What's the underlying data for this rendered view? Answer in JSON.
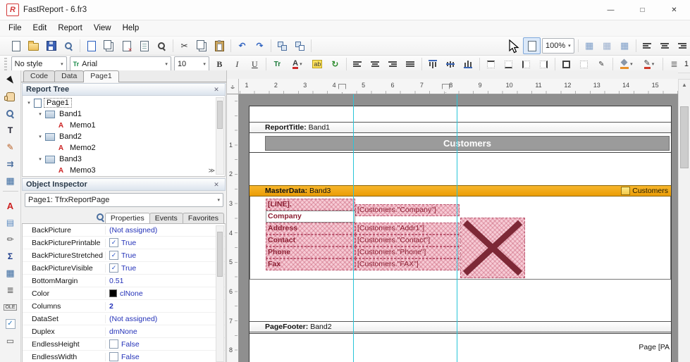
{
  "window": {
    "title": "FastReport - 6.fr3",
    "icon_letter": "R",
    "controls": [
      {
        "name": "minimize-button",
        "glyph": "—"
      },
      {
        "name": "maximize-button",
        "glyph": "□"
      },
      {
        "name": "close-button",
        "glyph": "✕"
      }
    ]
  },
  "menu": {
    "items": [
      "File",
      "Edit",
      "Report",
      "View",
      "Help"
    ]
  },
  "toolbar_main": {
    "zoom_value": "100%",
    "items_a": [
      {
        "name": "new-report-button",
        "cls": "css-page"
      },
      {
        "name": "open-report-button",
        "cls": "css-folder"
      },
      {
        "name": "save-report-button",
        "cls": "css-floppy"
      },
      {
        "name": "preview-button",
        "cls": "css-zoom"
      },
      {
        "name": "separator",
        "cls": "sep"
      },
      {
        "name": "new-report-page-button",
        "cls": "css-page pg-blue"
      },
      {
        "name": "new-dialog-page-button",
        "cls": "css-pages css-copy"
      },
      {
        "name": "delete-page-button",
        "cls": "css-page pg-del"
      },
      {
        "name": "page-settings-button",
        "cls": "css-page pg-set"
      },
      {
        "name": "find-button",
        "cls": "css-zoom zm-dark"
      },
      {
        "name": "separator",
        "cls": "sep"
      },
      {
        "name": "cut-button",
        "glyph": "✂"
      },
      {
        "name": "copy-button",
        "cls": "css-copy"
      },
      {
        "name": "paste-button",
        "cls": "css-paste"
      },
      {
        "name": "separator",
        "cls": "sep"
      },
      {
        "name": "undo-button",
        "glyph": "↶",
        "cls": "c-blue"
      },
      {
        "name": "redo-button",
        "glyph": "↷",
        "cls": "c-blue"
      },
      {
        "name": "separator",
        "cls": "sep"
      },
      {
        "name": "group-button",
        "cls": "css-group"
      },
      {
        "name": "ungroup-button",
        "cls": "css-ungroup"
      },
      {
        "name": "separator",
        "cls": "sep gap"
      },
      {
        "name": "zoom-page-button",
        "cls": "css-page hover"
      }
    ],
    "items_b": [
      {
        "name": "separator",
        "cls": "sep"
      },
      {
        "name": "show-grid-button",
        "glyph": "▦",
        "cls": "c-grid"
      },
      {
        "name": "align-to-grid-button",
        "glyph": "▦",
        "cls": "c-grid2"
      },
      {
        "name": "fit-to-grid-button",
        "glyph": "▦",
        "cls": "c-grid"
      },
      {
        "name": "separator",
        "cls": "sep"
      },
      {
        "name": "align-left-edges-button",
        "cls": "bars bl"
      },
      {
        "name": "align-centers-button",
        "cls": "bars bc"
      },
      {
        "name": "align-right-edges-button",
        "cls": "bars br"
      }
    ]
  },
  "toolbar_format": {
    "style_value": "No style",
    "font_type_icon": "Tr",
    "font_name": "Arial",
    "font_size": "10",
    "line_width": "1",
    "items": [
      {
        "name": "bold-button",
        "glyph": "B",
        "cls": "fb"
      },
      {
        "name": "italic-button",
        "glyph": "I",
        "cls": "fi"
      },
      {
        "name": "underline-button",
        "glyph": "U",
        "cls": "fu"
      },
      {
        "name": "separator",
        "cls": "sep"
      },
      {
        "name": "font-settings-button",
        "glyph": "Tr",
        "cls": "ftr"
      },
      {
        "name": "font-color-button",
        "glyph": "A",
        "cls": "fcolor drop"
      },
      {
        "name": "highlight-button",
        "glyph": "ab",
        "cls": "fhl"
      },
      {
        "name": "rotate-text-button",
        "glyph": "↻",
        "cls": "c-green"
      },
      {
        "name": "separator",
        "cls": "sep"
      },
      {
        "name": "align-left-button",
        "cls": "bars bl"
      },
      {
        "name": "align-center-button",
        "cls": "bars bc"
      },
      {
        "name": "align-right-button",
        "cls": "bars br"
      },
      {
        "name": "justify-button",
        "cls": "bars bj"
      },
      {
        "name": "separator",
        "cls": "sep"
      },
      {
        "name": "align-top-button",
        "cls": "vbars vt"
      },
      {
        "name": "align-middle-button",
        "cls": "vbars vm"
      },
      {
        "name": "align-bottom-button",
        "cls": "vbars vb"
      },
      {
        "name": "separator",
        "cls": "sep"
      },
      {
        "name": "frame-top-button",
        "cls": "fr frt"
      },
      {
        "name": "frame-bottom-button",
        "cls": "fr frb"
      },
      {
        "name": "frame-left-button",
        "cls": "fr frl"
      },
      {
        "name": "frame-right-button",
        "cls": "fr frr"
      },
      {
        "name": "separator",
        "cls": "sep"
      },
      {
        "name": "frame-all-button",
        "cls": "fr fra"
      },
      {
        "name": "frame-none-button",
        "cls": "fr frn"
      },
      {
        "name": "frame-edit-button",
        "glyph": "✎",
        "cls": "fredit"
      },
      {
        "name": "separator",
        "cls": "sep"
      },
      {
        "name": "fill-color-button",
        "cls": "css-fill drop"
      },
      {
        "name": "frame-color-button",
        "glyph": "✎",
        "cls": "fpen drop"
      },
      {
        "name": "separator",
        "cls": "sep"
      },
      {
        "name": "frame-width-icon",
        "glyph": "≣",
        "cls": "c-dim"
      }
    ]
  },
  "tools": [
    {
      "name": "select-tool",
      "cls": "t-sel"
    },
    {
      "name": "hand-tool",
      "cls": "css-hand"
    },
    {
      "name": "zoom-tool",
      "cls": "css-zoom"
    },
    {
      "name": "text-edit-tool",
      "glyph": "T",
      "cls": "t-text"
    },
    {
      "name": "format-painter-tool",
      "glyph": "✎",
      "cls": "t-paint"
    },
    {
      "name": "band-move-tool",
      "glyph": "⇉",
      "cls": "t-band"
    },
    {
      "name": "page-grid-tool",
      "glyph": "▦",
      "cls": "t-table"
    },
    {
      "name": "separator",
      "cls": "hsep"
    },
    {
      "name": "text-object-button",
      "glyph": "A",
      "cls": "t-A"
    },
    {
      "name": "picture-object-button",
      "glyph": "▤",
      "cls": "t-pic"
    },
    {
      "name": "shape-object-button",
      "glyph": "✏",
      "cls": "t-shape"
    },
    {
      "name": "system-text-object-button",
      "glyph": "Σ",
      "cls": "t-sigma"
    },
    {
      "name": "table-object-button",
      "glyph": "▦",
      "cls": "t-table"
    },
    {
      "name": "richtext-object-button",
      "glyph": "≣",
      "cls": "t-rich"
    },
    {
      "name": "ole-object-button",
      "glyph": "OLE",
      "cls": "t-ole"
    },
    {
      "name": "checkbox-object-button",
      "glyph": "✓",
      "cls": "t-check"
    },
    {
      "name": "line-object-button",
      "glyph": "▭",
      "cls": "t-line"
    }
  ],
  "tabs": {
    "items": [
      {
        "label": "Code"
      },
      {
        "label": "Data"
      },
      {
        "label": "Page1",
        "cls": "active"
      }
    ]
  },
  "report_tree": {
    "title": "Report Tree",
    "close_glyph": "✕",
    "overflow_glyph": "≫",
    "nodes": [
      {
        "label": "Page1",
        "depth": 0,
        "exp": "▾",
        "icls": "ti-pg",
        "ig": "",
        "cls": "focus"
      },
      {
        "label": "Band1",
        "depth": 1,
        "exp": "▾",
        "icls": "ti-bd",
        "ig": ""
      },
      {
        "label": "Memo1",
        "depth": 2,
        "exp": "",
        "icls": "ti-mm",
        "ig": "A"
      },
      {
        "label": "Band2",
        "depth": 1,
        "exp": "▾",
        "icls": "ti-bd",
        "ig": ""
      },
      {
        "label": "Memo2",
        "depth": 2,
        "exp": "",
        "icls": "ti-mm",
        "ig": "A"
      },
      {
        "label": "Band3",
        "depth": 1,
        "exp": "▾",
        "icls": "ti-bd",
        "ig": ""
      },
      {
        "label": "Memo3",
        "depth": 2,
        "exp": "",
        "icls": "ti-mm",
        "ig": "A"
      }
    ]
  },
  "inspector": {
    "title": "Object Inspector",
    "close_glyph": "✕",
    "object_selector": "Page1: TfrxReportPage",
    "tabs": [
      {
        "label": "Properties",
        "cls": "active"
      },
      {
        "label": "Events"
      },
      {
        "label": "Favorites"
      }
    ],
    "properties": [
      {
        "name": "BackPicture",
        "value": "(Not assigned)",
        "pre": "",
        "pcls": "none",
        "vcls": ""
      },
      {
        "name": "BackPicturePrintable",
        "value": "True",
        "pre": "✓",
        "pcls": "chk",
        "vcls": ""
      },
      {
        "name": "BackPictureStretched",
        "value": "True",
        "pre": "✓",
        "pcls": "chk",
        "vcls": ""
      },
      {
        "name": "BackPictureVisible",
        "value": "True",
        "pre": "✓",
        "pcls": "chk",
        "vcls": ""
      },
      {
        "name": "BottomMargin",
        "value": "0.51",
        "pre": "",
        "pcls": "none",
        "vcls": ""
      },
      {
        "name": "Color",
        "value": "clNone",
        "pre": "",
        "pcls": "swatch",
        "vcls": ""
      },
      {
        "name": "Columns",
        "value": "2",
        "pre": "",
        "pcls": "none",
        "vcls": "vbold"
      },
      {
        "name": "DataSet",
        "value": "(Not assigned)",
        "pre": "",
        "pcls": "none",
        "vcls": ""
      },
      {
        "name": "Duplex",
        "value": "dmNone",
        "pre": "",
        "pcls": "none",
        "vcls": ""
      },
      {
        "name": "EndlessHeight",
        "value": "False",
        "pre": "",
        "pcls": "chk",
        "vcls": ""
      },
      {
        "name": "EndlessWidth",
        "value": "False",
        "pre": "",
        "pcls": "chk",
        "vcls": ""
      }
    ]
  },
  "design": {
    "hruler": [
      "1",
      "2",
      "3",
      "4",
      "5",
      "6",
      "7",
      "8",
      "9",
      "10",
      "11",
      "12",
      "13",
      "14",
      "15"
    ],
    "vruler": [
      "1",
      "2",
      "3",
      "4",
      "5",
      "6",
      "7",
      "8"
    ],
    "bands": {
      "report_title": {
        "prefix": "ReportTitle:",
        "name": "Band1"
      },
      "master_data": {
        "prefix": "MasterData:",
        "name": "Band3",
        "dataset": "Customers"
      },
      "page_footer": {
        "prefix": "PageFooter:",
        "name": "Band2"
      }
    },
    "title_text": "Customers",
    "footer_text": "Page [PA",
    "labels": [
      {
        "text": "[LINE].",
        "cls": "sel"
      },
      {
        "text": "Company",
        "cls": "plain"
      },
      {
        "text": "Address",
        "cls": "sel"
      },
      {
        "text": "Contact",
        "cls": "sel"
      },
      {
        "text": "Phone",
        "cls": "sel"
      },
      {
        "text": "Fax",
        "cls": "sel"
      }
    ],
    "values": [
      {
        "text": "[Customers.\"Company\"]"
      },
      {
        "text": "[Customers.\"Addr1\"]"
      },
      {
        "text": "[Customers.\"Contact\"]"
      },
      {
        "text": "[Customers.\"Phone\"]"
      },
      {
        "text": "[Customers.\"FAX\"]"
      }
    ]
  }
}
